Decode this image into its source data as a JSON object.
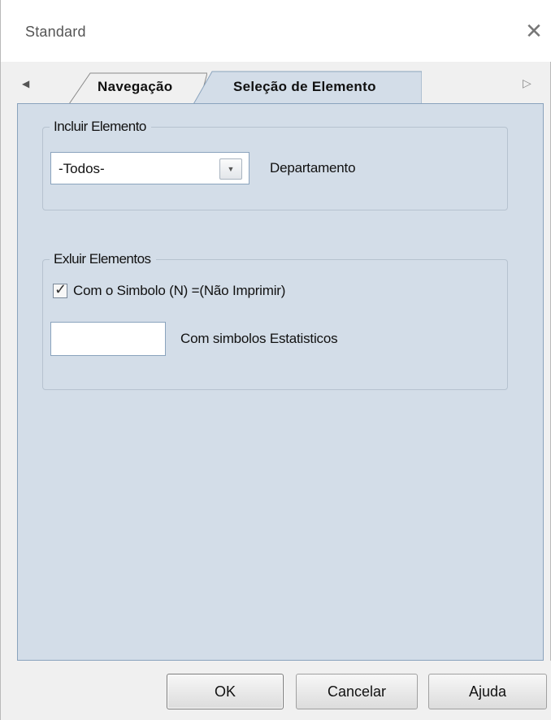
{
  "window": {
    "title": "Standard"
  },
  "tabs": [
    {
      "label": "Navegação",
      "active": false
    },
    {
      "label": "Seleção de Elemento",
      "active": true
    }
  ],
  "include_group": {
    "legend": "Incluir Elemento",
    "combo_value": "-Todos-",
    "combo_label": "Departamento"
  },
  "exclude_group": {
    "legend": "Exluir Elementos",
    "checkbox_label": "Com o Simbolo (N) =(Não Imprimir)",
    "checkbox_checked": true,
    "stat_value": "",
    "stat_label": "Com simbolos Estatisticos"
  },
  "buttons": {
    "ok": "OK",
    "cancel": "Cancelar",
    "help": "Ajuda"
  },
  "colors": {
    "panel": "#d3dde8",
    "panel_border": "#8aa3bd",
    "window": "#f0f0f0"
  }
}
